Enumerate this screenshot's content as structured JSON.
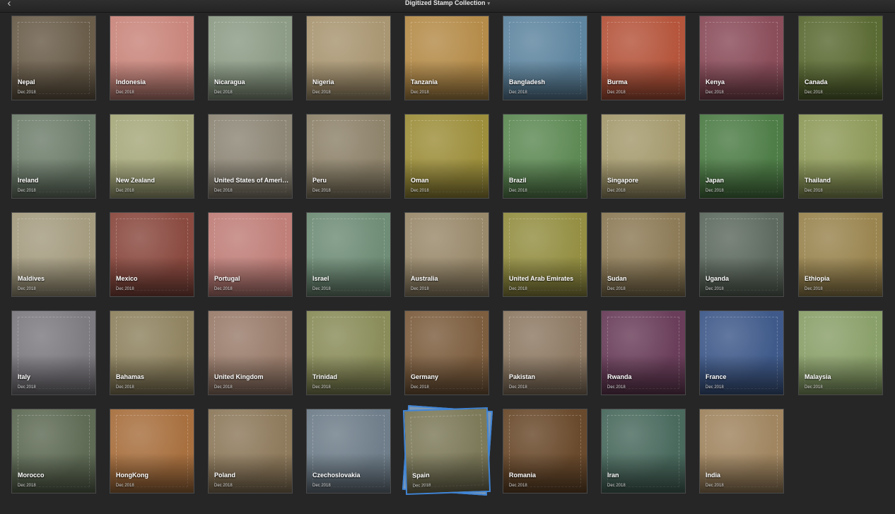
{
  "window": {
    "title": "Digitized Stamp Collection",
    "title_caret": "▾",
    "back_glyph": "‹"
  },
  "icons": {
    "back": "chevron-left-icon",
    "title_menu": "chevron-down-icon"
  },
  "colors": {
    "selection_accent": "#3f84d6",
    "background": "#262626"
  },
  "stamps": [
    {
      "country": "Nepal",
      "date": "Dec 2018",
      "color": "#6a5d4a"
    },
    {
      "country": "Indonesia",
      "date": "Dec 2018",
      "color": "#c9867c"
    },
    {
      "country": "Nicaragua",
      "date": "Dec 2018",
      "color": "#8d9c86"
    },
    {
      "country": "Nigeria",
      "date": "Dec 2018",
      "color": "#a99672"
    },
    {
      "country": "Tanzania",
      "date": "Dec 2018",
      "color": "#b58c4a"
    },
    {
      "country": "Bangladesh",
      "date": "Dec 2018",
      "color": "#5f86a0"
    },
    {
      "country": "Burma",
      "date": "Dec 2018",
      "color": "#b5553c"
    },
    {
      "country": "Kenya",
      "date": "Dec 2018",
      "color": "#8a4d5a"
    },
    {
      "country": "Canada",
      "date": "Dec 2018",
      "color": "#5b6b34"
    },
    {
      "country": "Ireland",
      "date": "Dec 2018",
      "color": "#6f7f6d"
    },
    {
      "country": "New Zealand",
      "date": "Dec 2018",
      "color": "#a7a97c"
    },
    {
      "country": "United States of America",
      "date": "Dec 2018",
      "color": "#8e8777"
    },
    {
      "country": "Peru",
      "date": "Dec 2018",
      "color": "#8e836b"
    },
    {
      "country": "Oman",
      "date": "Dec 2018",
      "color": "#9d8f3c"
    },
    {
      "country": "Brazil",
      "date": "Dec 2018",
      "color": "#5e8a55"
    },
    {
      "country": "Singapore",
      "date": "Dec 2018",
      "color": "#a59a6e"
    },
    {
      "country": "Japan",
      "date": "Dec 2018",
      "color": "#4e7d47"
    },
    {
      "country": "Thailand",
      "date": "Dec 2018",
      "color": "#8e9a5a"
    },
    {
      "country": "Maldives",
      "date": "Dec 2018",
      "color": "#a59c80"
    },
    {
      "country": "Mexico",
      "date": "Dec 2018",
      "color": "#8a4a40"
    },
    {
      "country": "Portugal",
      "date": "Dec 2018",
      "color": "#c07f79"
    },
    {
      "country": "Israel",
      "date": "Dec 2018",
      "color": "#6f8d77"
    },
    {
      "country": "Australia",
      "date": "Dec 2018",
      "color": "#9a8a6c"
    },
    {
      "country": "United Arab Emirates",
      "date": "Dec 2018",
      "color": "#948f43"
    },
    {
      "country": "Sudan",
      "date": "Dec 2018",
      "color": "#8d7b57"
    },
    {
      "country": "Uganda",
      "date": "Dec 2018",
      "color": "#5e6a5f"
    },
    {
      "country": "Ethiopia",
      "date": "Dec 2018",
      "color": "#9a8550"
    },
    {
      "country": "Italy",
      "date": "Dec 2018",
      "color": "#7d7a80"
    },
    {
      "country": "Bahamas",
      "date": "Dec 2018",
      "color": "#8f8360"
    },
    {
      "country": "United Kingdom",
      "date": "Dec 2018",
      "color": "#9a7d6c"
    },
    {
      "country": "Trinidad",
      "date": "Dec 2018",
      "color": "#8a8d5a"
    },
    {
      "country": "Germany",
      "date": "Dec 2018",
      "color": "#7d5e3f"
    },
    {
      "country": "Pakistan",
      "date": "Dec 2018",
      "color": "#8e7a64"
    },
    {
      "country": "Rwanda",
      "date": "Dec 2018",
      "color": "#6a3e5a"
    },
    {
      "country": "France",
      "date": "Dec 2018",
      "color": "#3f5a8a"
    },
    {
      "country": "Malaysia",
      "date": "Dec 2018",
      "color": "#8aa06a"
    },
    {
      "country": "Morocco",
      "date": "Dec 2018",
      "color": "#5f6b55"
    },
    {
      "country": "HongKong",
      "date": "Dec 2018",
      "color": "#a8703f"
    },
    {
      "country": "Poland",
      "date": "Dec 2018",
      "color": "#8e7a5c"
    },
    {
      "country": "Czechoslovakia",
      "date": "Dec 2018",
      "color": "#6f7e8a"
    },
    {
      "country": "Spain",
      "date": "Dec 2018",
      "color": "#7d7a5a"
    },
    {
      "country": "Romania",
      "date": "Dec 2018",
      "color": "#6a4a2c"
    },
    {
      "country": "Iran",
      "date": "Dec 2018",
      "color": "#4a6a5e"
    },
    {
      "country": "India",
      "date": "Dec 2018",
      "color": "#a08560"
    }
  ],
  "selected_stamp": "Spain"
}
